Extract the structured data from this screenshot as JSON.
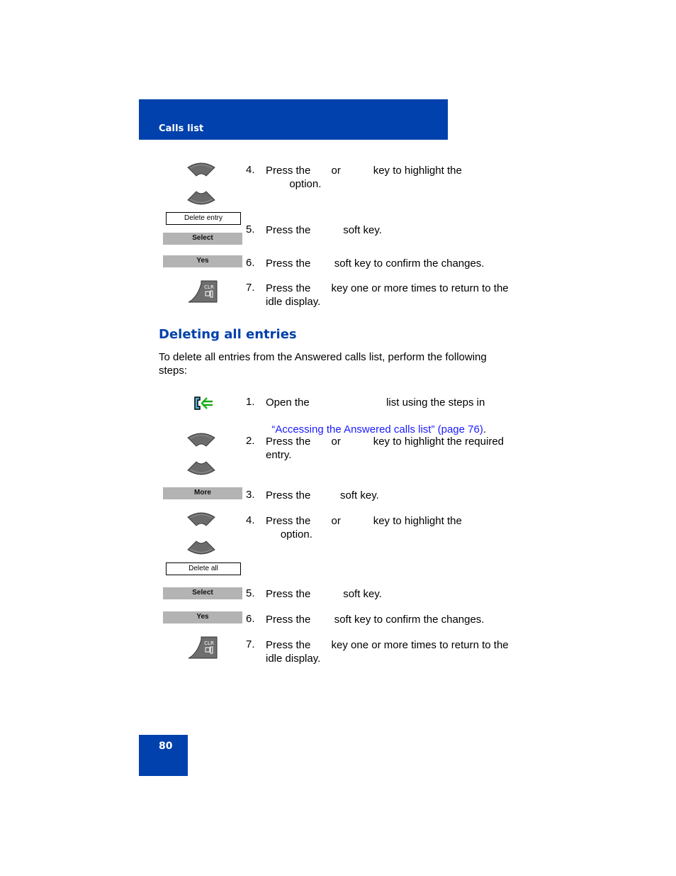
{
  "header": {
    "title": "Calls list"
  },
  "section1": {
    "steps": [
      {
        "num": "4.",
        "line1": "Press the       or           key to highlight the",
        "line2": "        option.",
        "icon": "nav-up-down-keys",
        "option_label": "Delete entry"
      },
      {
        "num": "5.",
        "line1": "Press the           soft key.",
        "softkey": "Select"
      },
      {
        "num": "6.",
        "line1": "Press the        soft key to confirm the changes.",
        "softkey": "Yes"
      },
      {
        "num": "7.",
        "line1": "Press the       key one or more times to return to the",
        "line2": "idle display.",
        "icon": "clr-key",
        "key_label": "CLR"
      }
    ]
  },
  "section2": {
    "title": "Deleting all entries",
    "intro": "To delete all entries from the Answered calls list, perform the following steps:",
    "steps": [
      {
        "num": "1.",
        "line1": "Open the                          list using the steps in",
        "link": "“Accessing the Answered calls list” (page 76)",
        "link_suffix": ".",
        "icon": "answered-calls-icon"
      },
      {
        "num": "2.",
        "line1": "Press the       or           key to highlight the required",
        "line2": "entry.",
        "icon": "nav-up-down-keys"
      },
      {
        "num": "3.",
        "line1": "Press the          soft key.",
        "softkey": "More"
      },
      {
        "num": "4.",
        "line1": "Press the       or           key to highlight the",
        "line2": "     option.",
        "icon": "nav-up-down-keys",
        "option_label": "Delete all"
      },
      {
        "num": "5.",
        "line1": "Press the           soft key.",
        "softkey": "Select"
      },
      {
        "num": "6.",
        "line1": "Press the        soft key to confirm the changes.",
        "softkey": "Yes"
      },
      {
        "num": "7.",
        "line1": "Press the       key one or more times to return to the",
        "line2": "idle display.",
        "icon": "clr-key",
        "key_label": "CLR"
      }
    ]
  },
  "footer": {
    "page_number": "80"
  },
  "colors": {
    "brand_blue": "#0041ad",
    "link_blue": "#1a1aff",
    "softkey_gray": "#b3b3b3"
  }
}
